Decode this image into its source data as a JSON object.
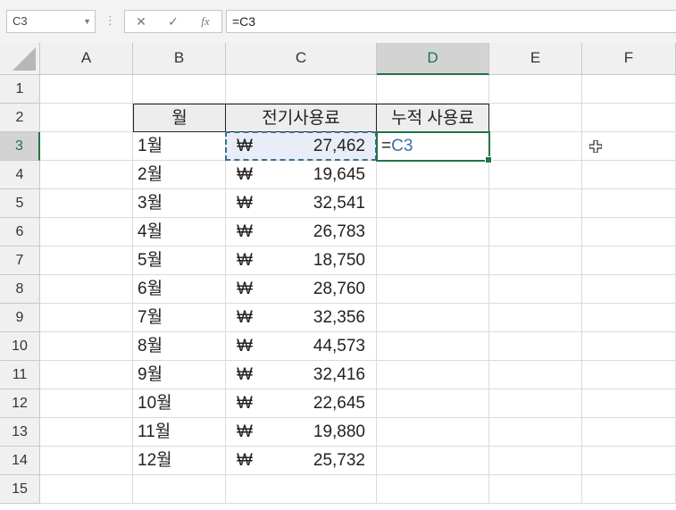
{
  "formula_bar": {
    "name_box": "C3",
    "cancel_icon": "✕",
    "enter_icon": "✓",
    "fx_icon": "fx",
    "formula": "=C3"
  },
  "columns": [
    "A",
    "B",
    "C",
    "D",
    "E",
    "F"
  ],
  "selected_column": "D",
  "rows": [
    "1",
    "2",
    "3",
    "4",
    "5",
    "6",
    "7",
    "8",
    "9",
    "10",
    "11",
    "12",
    "13",
    "14",
    "15"
  ],
  "selected_row": "3",
  "table": {
    "headers": [
      "월",
      "전기사용료",
      "누적 사용료"
    ],
    "currency_symbol": "₩",
    "months": [
      "1월",
      "2월",
      "3월",
      "4월",
      "5월",
      "6월",
      "7월",
      "8월",
      "9월",
      "10월",
      "11월",
      "12월"
    ],
    "amounts": [
      "27,462",
      "19,645",
      "32,541",
      "26,783",
      "18,750",
      "28,760",
      "32,356",
      "44,573",
      "32,416",
      "22,645",
      "19,880",
      "25,732"
    ]
  },
  "active_cell": {
    "address": "D3",
    "edit_prefix": "=",
    "edit_ref": "C3"
  },
  "copy_source": "C3",
  "icons": {
    "namebox_dropdown": "chevron-down-icon",
    "cursor": "crosshair-cursor-icon"
  },
  "colors": {
    "accent": "#217346",
    "reference": "#3a6fb0"
  }
}
